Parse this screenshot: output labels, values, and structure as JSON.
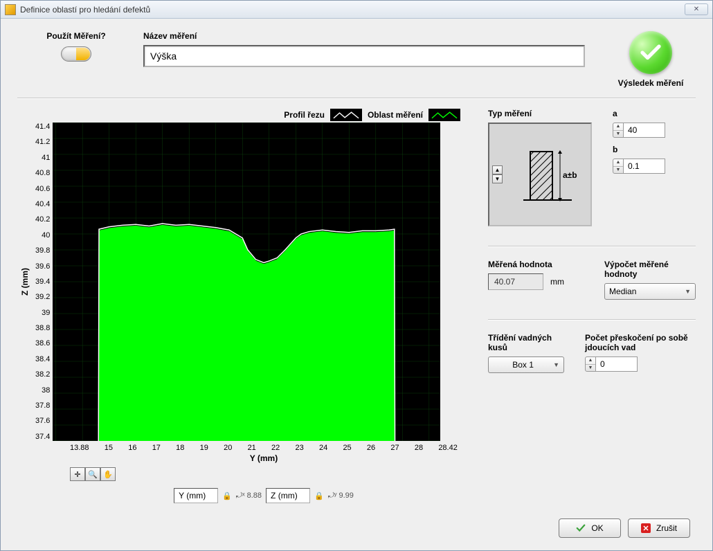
{
  "window": {
    "title": "Definice oblastí pro hledání defektů",
    "close_x": "✕"
  },
  "top": {
    "use_label": "Použít Měření?",
    "name_label": "Název měření",
    "name_value": "Výška",
    "result_label": "Výsledek měření"
  },
  "legend": {
    "profile": "Profil řezu",
    "area": "Oblast měření"
  },
  "controls": {
    "type_label": "Typ měření",
    "type_formula": "a±b",
    "a_label": "a",
    "a_value": "40",
    "b_label": "b",
    "b_value": "0.1",
    "measured_label": "Měřená hodnota",
    "measured_value": "40.07",
    "measured_unit": "mm",
    "calc_label": "Výpočet měřené hodnoty",
    "calc_value": "Median",
    "sort_label": "Třídění vadných kusů",
    "sort_value": "Box 1",
    "skip_label": "Počet přeskočení po sobě jdoucích vad",
    "skip_value": "0"
  },
  "axis": {
    "y_name": "Y (mm)",
    "z_name": "Z (mm)",
    "y_label": "Y (mm)",
    "z_label": "Z (mm)",
    "lock_y_fmt": "8.88",
    "lock_z_fmt": "9.99"
  },
  "buttons": {
    "ok": "OK",
    "cancel": "Zrušit"
  },
  "chart_data": {
    "type": "line",
    "title": "",
    "xlabel": "Y (mm)",
    "ylabel": "Z (mm)",
    "xlim": [
      13.88,
      28.42
    ],
    "ylim": [
      37.4,
      41.4
    ],
    "xticks": [
      13.88,
      15,
      16,
      17,
      18,
      19,
      20,
      21,
      22,
      23,
      24,
      25,
      26,
      27,
      28,
      28.42
    ],
    "yticks": [
      41.4,
      41.2,
      41,
      40.8,
      40.6,
      40.4,
      40.2,
      40,
      39.8,
      39.6,
      39.4,
      39.2,
      39,
      38.8,
      38.6,
      38.4,
      38.2,
      38,
      37.8,
      37.6,
      37.4
    ],
    "series": [
      {
        "name": "Profil řezu",
        "color": "#ffffff",
        "x": [
          15.6,
          15.62,
          16.0,
          16.5,
          17.0,
          17.5,
          18.0,
          18.5,
          19.0,
          19.5,
          20.0,
          20.5,
          21.0,
          21.2,
          21.5,
          21.8,
          22.0,
          22.3,
          22.6,
          23.0,
          23.2,
          23.5,
          24.0,
          24.5,
          25.0,
          25.5,
          26.0,
          26.5,
          26.7,
          26.72
        ],
        "y": [
          37.4,
          40.06,
          40.09,
          40.11,
          40.12,
          40.1,
          40.13,
          40.11,
          40.12,
          40.1,
          40.08,
          40.05,
          39.95,
          39.8,
          39.68,
          39.64,
          39.66,
          39.7,
          39.8,
          39.95,
          40.0,
          40.03,
          40.05,
          40.03,
          40.02,
          40.04,
          40.04,
          40.05,
          40.06,
          37.4
        ]
      },
      {
        "name": "Oblast měření",
        "color": "#00ff00",
        "fill": true,
        "x": [
          15.6,
          15.62,
          16.0,
          16.5,
          17.0,
          17.5,
          18.0,
          18.5,
          19.0,
          19.5,
          20.0,
          20.5,
          21.0,
          21.2,
          21.5,
          21.8,
          22.0,
          22.3,
          22.6,
          23.0,
          23.2,
          23.5,
          24.0,
          24.5,
          25.0,
          25.5,
          26.0,
          26.5,
          26.7,
          26.72
        ],
        "y": [
          37.4,
          40.04,
          40.07,
          40.09,
          40.1,
          40.08,
          40.11,
          40.09,
          40.1,
          40.08,
          40.06,
          40.03,
          39.93,
          39.78,
          39.66,
          39.62,
          39.64,
          39.68,
          39.78,
          39.93,
          39.98,
          40.01,
          40.03,
          40.01,
          40.0,
          40.02,
          40.02,
          40.03,
          40.04,
          37.4
        ]
      }
    ]
  }
}
